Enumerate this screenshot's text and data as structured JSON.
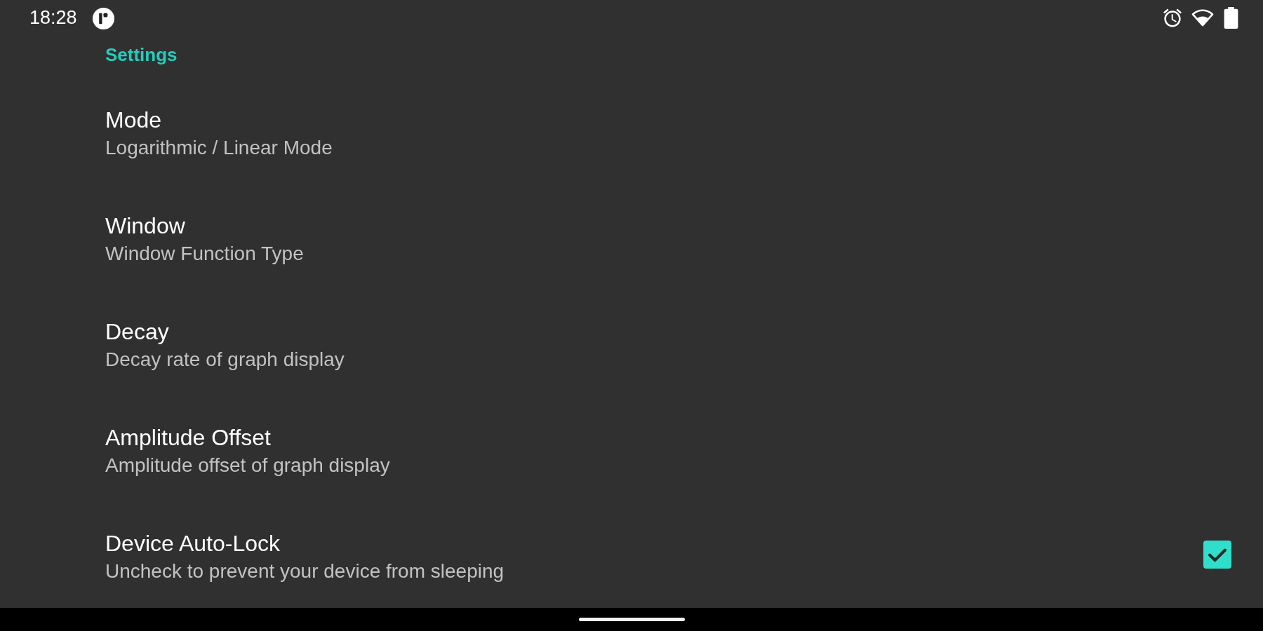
{
  "status_bar": {
    "time": "18:28"
  },
  "header": {
    "title": "Settings"
  },
  "preferences": [
    {
      "kind": "plain",
      "title": "Mode",
      "summary": "Logarithmic / Linear Mode"
    },
    {
      "kind": "plain",
      "title": "Window",
      "summary": "Window Function Type"
    },
    {
      "kind": "plain",
      "title": "Decay",
      "summary": "Decay rate of graph display"
    },
    {
      "kind": "plain",
      "title": "Amplitude Offset",
      "summary": "Amplitude offset of graph display"
    },
    {
      "kind": "checkbox",
      "title": "Device Auto-Lock",
      "summary": "Uncheck to prevent your device from sleeping",
      "checked": true
    }
  ]
}
